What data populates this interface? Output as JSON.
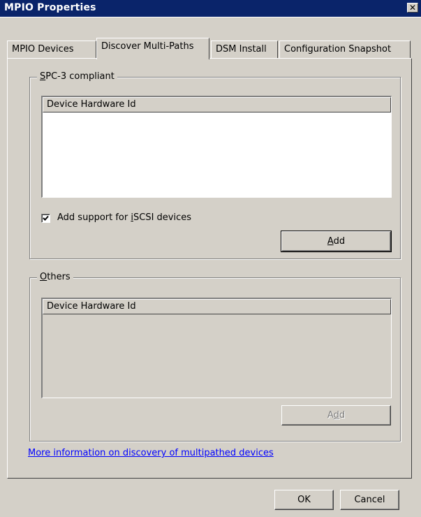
{
  "window": {
    "title": "MPIO Properties",
    "close_glyph": "✕"
  },
  "tabs": [
    {
      "label": "MPIO Devices"
    },
    {
      "label": "Discover Multi-Paths",
      "active": true
    },
    {
      "label": "DSM Install"
    },
    {
      "label": "Configuration Snapshot"
    }
  ],
  "spc3": {
    "label_mnemonic": "S",
    "label_rest": "PC-3 compliant",
    "column_header": "Device Hardware Id",
    "checkbox_pre": "Add support for ",
    "checkbox_mnemonic": "i",
    "checkbox_post": "SCSI devices",
    "checkbox_checked": true,
    "add_mnemonic": "A",
    "add_rest": "dd"
  },
  "others": {
    "label_mnemonic": "O",
    "label_rest": "thers",
    "column_header": "Device Hardware Id",
    "add_pre": "A",
    "add_mnemonic": "d",
    "add_post": "d",
    "add_disabled": true
  },
  "link_text": "More information on discovery of multipathed devices",
  "footer": {
    "ok_label": "OK",
    "cancel_label": "Cancel"
  },
  "colors": {
    "titlebar": "#0a246a",
    "dialog_bg": "#d4d0c8",
    "link": "#0000ff"
  }
}
